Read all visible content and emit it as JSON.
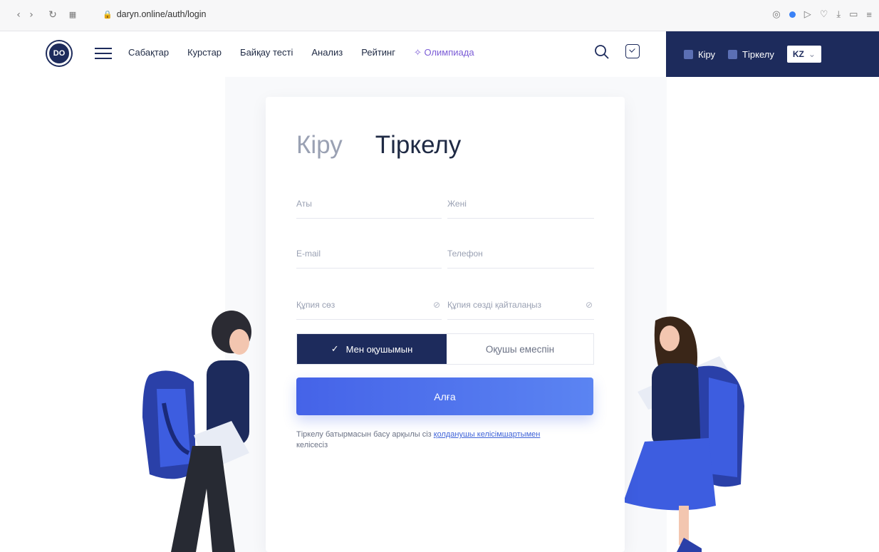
{
  "browser": {
    "url": "daryn.online/auth/login"
  },
  "nav": {
    "logo_text": "DO",
    "links": [
      "Сабақтар",
      "Курстар",
      "Байқау тесті",
      "Анализ",
      "Рейтинг",
      "Олимпиада"
    ],
    "olympiad_icon": "sparkle-icon",
    "login_label": "Кіру",
    "register_label": "Тіркелу",
    "language": "KZ"
  },
  "form": {
    "tab_login": "Кіру",
    "tab_register": "Тіркелу",
    "first_name": "Аты",
    "last_name": "Жені",
    "email": "E-mail",
    "phone": "Телефон",
    "password": "Құпия сөз",
    "password_repeat": "Құпия сөзді қайталаңыз",
    "role_student": "Мен оқушымын",
    "role_not_student": "Оқушы емеспін",
    "submit": "Алға",
    "terms_prefix": "Тіркелу батырмасын басу арқылы сіз ",
    "terms_link": "қолданушы келісімшартымен",
    "terms_suffix": " келісесіз"
  },
  "colors": {
    "brand_dark": "#1d2b5c",
    "accent_blue": "#4563e8",
    "olympiad": "#7b5cd6"
  }
}
